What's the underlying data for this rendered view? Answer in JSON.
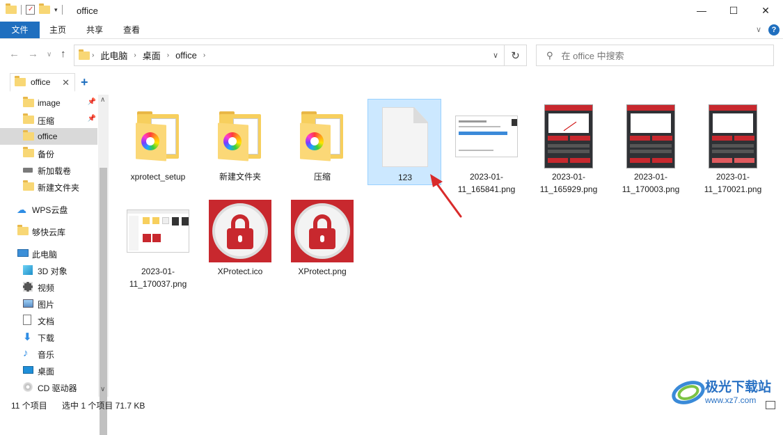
{
  "window": {
    "title": "office",
    "minimize": "—",
    "maximize": "☐",
    "close": "✕"
  },
  "ribbon": {
    "tabs": [
      "文件",
      "主页",
      "共享",
      "查看"
    ]
  },
  "address": {
    "segments": [
      "此电脑",
      "桌面",
      "office"
    ],
    "search_placeholder": "在 office 中搜索"
  },
  "tab": {
    "label": "office"
  },
  "sidebar": {
    "items": [
      {
        "label": "image",
        "icon": "folder-icon",
        "pinned": true
      },
      {
        "label": "压缩",
        "icon": "folder-icon",
        "pinned": true
      },
      {
        "label": "office",
        "icon": "folder-icon",
        "selected": true
      },
      {
        "label": "备份",
        "icon": "folder-icon"
      },
      {
        "label": "新加载卷",
        "icon": "drive-icon"
      },
      {
        "label": "新建文件夹",
        "icon": "folder-icon"
      },
      {
        "label": "WPS云盘",
        "icon": "cloud-icon"
      },
      {
        "label": "够快云库",
        "icon": "folder-icon"
      },
      {
        "label": "此电脑",
        "icon": "computer-icon"
      },
      {
        "label": "3D 对象",
        "icon": "cube-icon"
      },
      {
        "label": "视频",
        "icon": "video-icon"
      },
      {
        "label": "图片",
        "icon": "picture-icon"
      },
      {
        "label": "文档",
        "icon": "document-icon"
      },
      {
        "label": "下载",
        "icon": "download-icon"
      },
      {
        "label": "音乐",
        "icon": "music-icon"
      },
      {
        "label": "桌面",
        "icon": "desktop-icon"
      },
      {
        "label": "CD 驱动器",
        "icon": "cd-drive-icon"
      }
    ]
  },
  "files": [
    {
      "name": "xprotect_setup",
      "type": "folder"
    },
    {
      "name": "新建文件夹",
      "type": "folder"
    },
    {
      "name": "压缩",
      "type": "folder"
    },
    {
      "name": "123",
      "type": "blank",
      "selected": true
    },
    {
      "name": "2023-01-11_165841.png",
      "type": "dialog-shot"
    },
    {
      "name": "2023-01-11_165929.png",
      "type": "app-shot"
    },
    {
      "name": "2023-01-11_170003.png",
      "type": "app-shot"
    },
    {
      "name": "2023-01-11_170021.png",
      "type": "app-shot"
    },
    {
      "name": "2023-01-11_170037.png",
      "type": "explorer-shot"
    },
    {
      "name": "XProtect.ico",
      "type": "lock"
    },
    {
      "name": "XProtect.png",
      "type": "lock"
    }
  ],
  "status": {
    "count": "11 个项目",
    "selection": "选中 1 个项目  71.7 KB"
  },
  "watermark": {
    "text": "极光下载站",
    "url": "www.xz7.com"
  },
  "colors": {
    "accent": "#1f6fbf",
    "selection": "#cce8ff",
    "brand_red": "#c8282e"
  }
}
